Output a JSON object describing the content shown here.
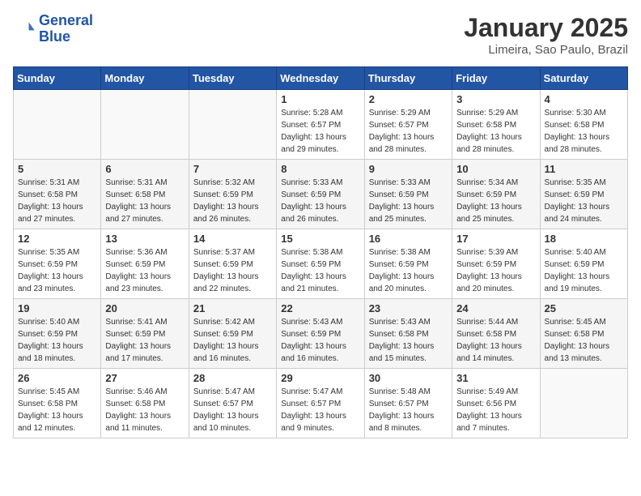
{
  "header": {
    "logo_line1": "General",
    "logo_line2": "Blue",
    "month": "January 2025",
    "location": "Limeira, Sao Paulo, Brazil"
  },
  "days_of_week": [
    "Sunday",
    "Monday",
    "Tuesday",
    "Wednesday",
    "Thursday",
    "Friday",
    "Saturday"
  ],
  "weeks": [
    [
      {
        "day": "",
        "info": ""
      },
      {
        "day": "",
        "info": ""
      },
      {
        "day": "",
        "info": ""
      },
      {
        "day": "1",
        "info": "Sunrise: 5:28 AM\nSunset: 6:57 PM\nDaylight: 13 hours and 29 minutes."
      },
      {
        "day": "2",
        "info": "Sunrise: 5:29 AM\nSunset: 6:57 PM\nDaylight: 13 hours and 28 minutes."
      },
      {
        "day": "3",
        "info": "Sunrise: 5:29 AM\nSunset: 6:58 PM\nDaylight: 13 hours and 28 minutes."
      },
      {
        "day": "4",
        "info": "Sunrise: 5:30 AM\nSunset: 6:58 PM\nDaylight: 13 hours and 28 minutes."
      }
    ],
    [
      {
        "day": "5",
        "info": "Sunrise: 5:31 AM\nSunset: 6:58 PM\nDaylight: 13 hours and 27 minutes."
      },
      {
        "day": "6",
        "info": "Sunrise: 5:31 AM\nSunset: 6:58 PM\nDaylight: 13 hours and 27 minutes."
      },
      {
        "day": "7",
        "info": "Sunrise: 5:32 AM\nSunset: 6:59 PM\nDaylight: 13 hours and 26 minutes."
      },
      {
        "day": "8",
        "info": "Sunrise: 5:33 AM\nSunset: 6:59 PM\nDaylight: 13 hours and 26 minutes."
      },
      {
        "day": "9",
        "info": "Sunrise: 5:33 AM\nSunset: 6:59 PM\nDaylight: 13 hours and 25 minutes."
      },
      {
        "day": "10",
        "info": "Sunrise: 5:34 AM\nSunset: 6:59 PM\nDaylight: 13 hours and 25 minutes."
      },
      {
        "day": "11",
        "info": "Sunrise: 5:35 AM\nSunset: 6:59 PM\nDaylight: 13 hours and 24 minutes."
      }
    ],
    [
      {
        "day": "12",
        "info": "Sunrise: 5:35 AM\nSunset: 6:59 PM\nDaylight: 13 hours and 23 minutes."
      },
      {
        "day": "13",
        "info": "Sunrise: 5:36 AM\nSunset: 6:59 PM\nDaylight: 13 hours and 23 minutes."
      },
      {
        "day": "14",
        "info": "Sunrise: 5:37 AM\nSunset: 6:59 PM\nDaylight: 13 hours and 22 minutes."
      },
      {
        "day": "15",
        "info": "Sunrise: 5:38 AM\nSunset: 6:59 PM\nDaylight: 13 hours and 21 minutes."
      },
      {
        "day": "16",
        "info": "Sunrise: 5:38 AM\nSunset: 6:59 PM\nDaylight: 13 hours and 20 minutes."
      },
      {
        "day": "17",
        "info": "Sunrise: 5:39 AM\nSunset: 6:59 PM\nDaylight: 13 hours and 20 minutes."
      },
      {
        "day": "18",
        "info": "Sunrise: 5:40 AM\nSunset: 6:59 PM\nDaylight: 13 hours and 19 minutes."
      }
    ],
    [
      {
        "day": "19",
        "info": "Sunrise: 5:40 AM\nSunset: 6:59 PM\nDaylight: 13 hours and 18 minutes."
      },
      {
        "day": "20",
        "info": "Sunrise: 5:41 AM\nSunset: 6:59 PM\nDaylight: 13 hours and 17 minutes."
      },
      {
        "day": "21",
        "info": "Sunrise: 5:42 AM\nSunset: 6:59 PM\nDaylight: 13 hours and 16 minutes."
      },
      {
        "day": "22",
        "info": "Sunrise: 5:43 AM\nSunset: 6:59 PM\nDaylight: 13 hours and 16 minutes."
      },
      {
        "day": "23",
        "info": "Sunrise: 5:43 AM\nSunset: 6:58 PM\nDaylight: 13 hours and 15 minutes."
      },
      {
        "day": "24",
        "info": "Sunrise: 5:44 AM\nSunset: 6:58 PM\nDaylight: 13 hours and 14 minutes."
      },
      {
        "day": "25",
        "info": "Sunrise: 5:45 AM\nSunset: 6:58 PM\nDaylight: 13 hours and 13 minutes."
      }
    ],
    [
      {
        "day": "26",
        "info": "Sunrise: 5:45 AM\nSunset: 6:58 PM\nDaylight: 13 hours and 12 minutes."
      },
      {
        "day": "27",
        "info": "Sunrise: 5:46 AM\nSunset: 6:58 PM\nDaylight: 13 hours and 11 minutes."
      },
      {
        "day": "28",
        "info": "Sunrise: 5:47 AM\nSunset: 6:57 PM\nDaylight: 13 hours and 10 minutes."
      },
      {
        "day": "29",
        "info": "Sunrise: 5:47 AM\nSunset: 6:57 PM\nDaylight: 13 hours and 9 minutes."
      },
      {
        "day": "30",
        "info": "Sunrise: 5:48 AM\nSunset: 6:57 PM\nDaylight: 13 hours and 8 minutes."
      },
      {
        "day": "31",
        "info": "Sunrise: 5:49 AM\nSunset: 6:56 PM\nDaylight: 13 hours and 7 minutes."
      },
      {
        "day": "",
        "info": ""
      }
    ]
  ]
}
